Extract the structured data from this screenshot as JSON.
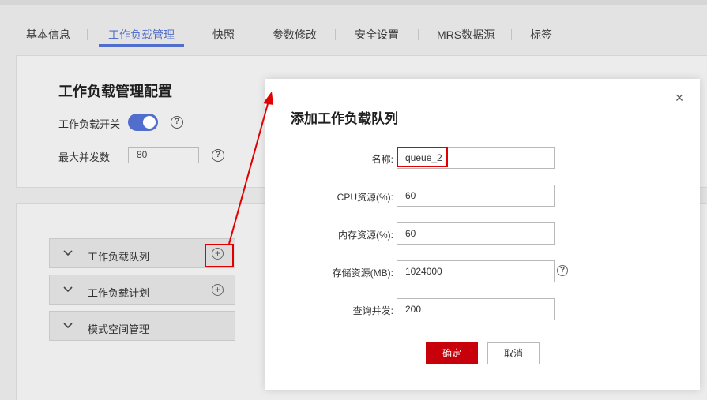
{
  "tabs": [
    {
      "label": "基本信息"
    },
    {
      "label": "工作负载管理"
    },
    {
      "label": "快照"
    },
    {
      "label": "参数修改"
    },
    {
      "label": "安全设置"
    },
    {
      "label": "MRS数据源"
    },
    {
      "label": "标签"
    }
  ],
  "active_tab": "工作负载管理",
  "config": {
    "title": "工作负载管理配置",
    "switch_label": "工作负载开关",
    "switch_on": true,
    "max_concurrency_label": "最大并发数",
    "max_concurrency_value": "80",
    "help_glyph": "?"
  },
  "accordion": [
    {
      "label": "工作负载队列",
      "add_glyph": "+"
    },
    {
      "label": "工作负载计划",
      "add_glyph": "+"
    },
    {
      "label": "模式空间管理"
    }
  ],
  "dialog": {
    "title": "添加工作负载队列",
    "close_glyph": "×",
    "fields": [
      {
        "label": "名称:",
        "value": "queue_2"
      },
      {
        "label": "CPU资源(%):",
        "value": "60"
      },
      {
        "label": "内存资源(%):",
        "value": "60"
      },
      {
        "label": "存储资源(MB):",
        "value": "1024000"
      },
      {
        "label": "查询并发:",
        "value": "200"
      }
    ],
    "confirm_label": "确定",
    "cancel_label": "取消"
  },
  "colors": {
    "accent": "#526ecc",
    "primary_button": "#c7000b",
    "highlight": "#e00000"
  },
  "icons": [
    "help-icon",
    "chevron-down-icon",
    "add-circle-icon",
    "close-icon",
    "annotation-arrow"
  ]
}
